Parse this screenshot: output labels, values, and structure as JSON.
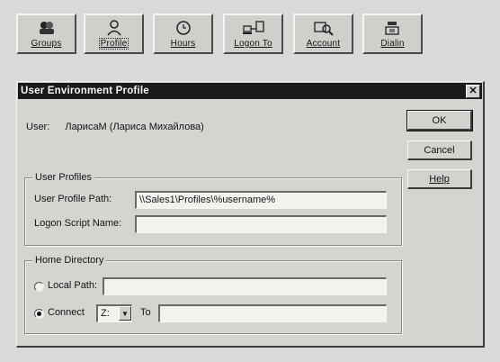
{
  "toolbar": {
    "buttons": [
      {
        "label": "Groups",
        "icon": "groups-icon"
      },
      {
        "label": "Profile",
        "icon": "profile-icon",
        "active": true
      },
      {
        "label": "Hours",
        "icon": "clock-icon"
      },
      {
        "label": "Logon To",
        "icon": "computers-icon"
      },
      {
        "label": "Account",
        "icon": "account-icon"
      },
      {
        "label": "Dialin",
        "icon": "phone-icon"
      }
    ]
  },
  "dialog": {
    "title": "User Environment Profile",
    "close_glyph": "✕",
    "user_label": "User:",
    "user_value": "ЛарисаМ (Лариса Михайлова)",
    "buttons": {
      "ok": "OK",
      "cancel": "Cancel",
      "help": "Help"
    },
    "user_profiles": {
      "legend": "User Profiles",
      "profile_path_label": "User Profile Path:",
      "profile_path_value": "\\\\Sales1\\Profiles\\%username%",
      "logon_script_label": "Logon Script Name:",
      "logon_script_value": ""
    },
    "home_directory": {
      "legend": "Home Directory",
      "local_path_label": "Local Path:",
      "local_path_value": "",
      "connect_label": "Connect",
      "drive_value": "Z:",
      "to_label": "To",
      "to_value": "",
      "selected": "connect"
    }
  },
  "colors": {
    "titlebar": "#1a1a1a",
    "face": "#d4d4d1",
    "desktop": "#d9d9d7"
  }
}
